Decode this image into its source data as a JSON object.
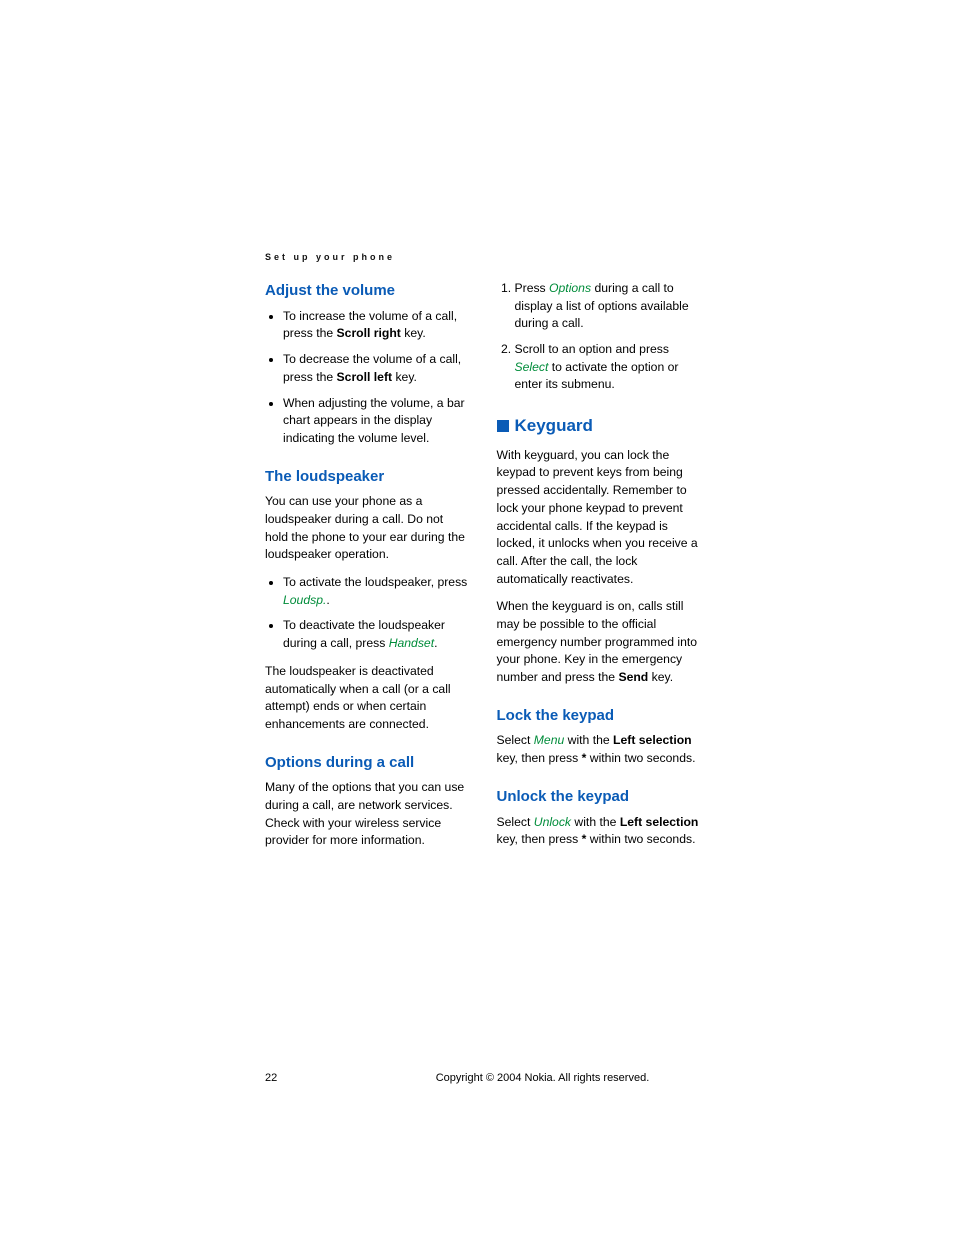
{
  "header": "Set up your phone",
  "left": {
    "h_volume": "Adjust the volume",
    "vol_b1_a": "To increase the volume of a call, press the ",
    "vol_b1_b": "Scroll right",
    "vol_b1_c": " key.",
    "vol_b2_a": "To decrease the volume of a call, press the ",
    "vol_b2_b": "Scroll left",
    "vol_b2_c": " key.",
    "vol_b3": "When adjusting the volume, a bar chart appears in the display indicating the volume level.",
    "h_loud": "The loudspeaker",
    "loud_p1": "You can use your phone as a loudspeaker during a call. Do not hold the phone to your ear during the loudspeaker operation.",
    "loud_b1_a": "To activate the loudspeaker, press ",
    "loud_b1_kw": "Loudsp.",
    "loud_b1_c": ".",
    "loud_b2_a": "To deactivate the loudspeaker during a call, press ",
    "loud_b2_kw": "Handset",
    "loud_b2_c": ".",
    "loud_p2": "The loudspeaker is deactivated automatically when a call (or a call attempt) ends or when certain enhancements are connected.",
    "h_opt": "Options during a call",
    "opt_p1": "Many of the options that you can use during a call, are network services. Check with your wireless service provider for more information."
  },
  "right": {
    "ol1_a": "Press ",
    "ol1_kw": "Options",
    "ol1_b": " during a call to display a list of options available during a call.",
    "ol2_a": "Scroll to an option and press ",
    "ol2_kw": "Select",
    "ol2_b": " to activate the option or enter its submenu.",
    "h_keyguard": "Keyguard",
    "kg_p1": "With keyguard, you can lock the keypad to prevent keys from being pressed accidentally. Remember to lock your phone keypad to prevent accidental calls. If the keypad is locked, it unlocks when you receive a call. After the call, the lock automatically reactivates.",
    "kg_p2_a": "When the keyguard is on, calls still may be possible to the official emergency number programmed into your phone. Key in the emergency number and press the ",
    "kg_p2_b": "Send",
    "kg_p2_c": " key.",
    "h_lock": "Lock the keypad",
    "lock_a": "Select ",
    "lock_kw": "Menu",
    "lock_b": " with the ",
    "lock_bold": "Left selection",
    "lock_c": " key, then press ",
    "lock_star": "*",
    "lock_d": " within two seconds.",
    "h_unlock": "Unlock the keypad",
    "unlock_a": "Select ",
    "unlock_kw": "Unlock",
    "unlock_b": " with the ",
    "unlock_bold": "Left selection",
    "unlock_c": " key, then press ",
    "unlock_star": "*",
    "unlock_d": " within two seconds."
  },
  "footer": {
    "page": "22",
    "copy": "Copyright © 2004 Nokia. All rights reserved."
  }
}
